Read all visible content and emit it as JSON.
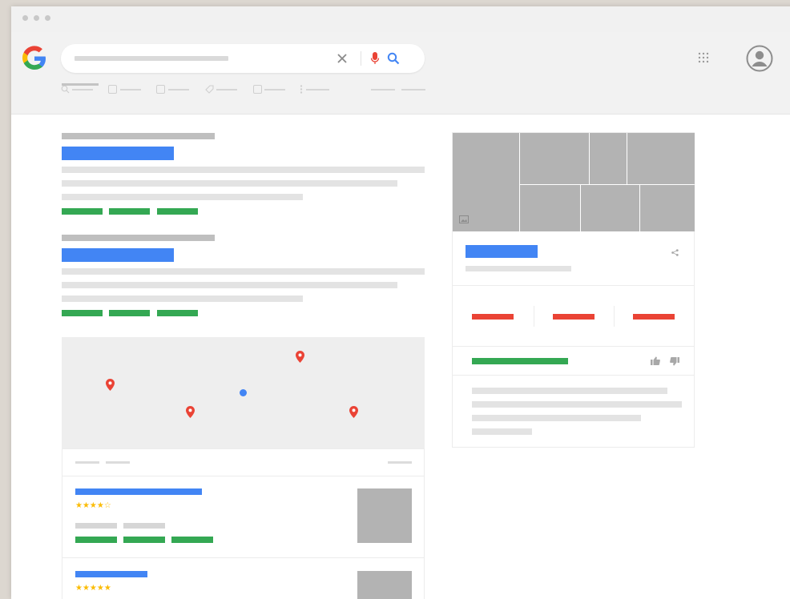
{
  "browser": {
    "dots": 3
  },
  "logo": {
    "letter": "G",
    "colors": [
      "#4285f4",
      "#ea4335",
      "#fbbc05",
      "#34a853"
    ]
  },
  "search": {
    "icons": [
      "clear-icon",
      "mic-icon",
      "search-icon"
    ],
    "mic_color": "#ea4335",
    "search_color": "#4285f4"
  },
  "header_icons": [
    "apps-grid-icon",
    "account-avatar-icon"
  ],
  "tabs": [
    "search-tab-icon",
    "news-tab-icon",
    "images-tab-icon",
    "shopping-tab-icon",
    "videos-tab-icon",
    "more-tab-icon"
  ],
  "results": [
    {
      "name": "result-1"
    },
    {
      "name": "result-2"
    }
  ],
  "map": {
    "pins": 4,
    "pin_color": "#ea4335",
    "current_location_color": "#4285f4"
  },
  "local_listings": [
    {
      "rating": "★★★★☆"
    },
    {
      "rating": "★★★★★"
    }
  ],
  "knowledge_panel": {
    "icons": [
      "share-icon",
      "thumbs-up-icon",
      "thumbs-down-icon",
      "image-gallery-icon"
    ]
  },
  "colors": {
    "link_blue": "#4285f4",
    "url_green": "#34a853",
    "action_red": "#ea4335",
    "star_yellow": "#fbbc05",
    "placeholder_grey": "#bfbfbf"
  }
}
